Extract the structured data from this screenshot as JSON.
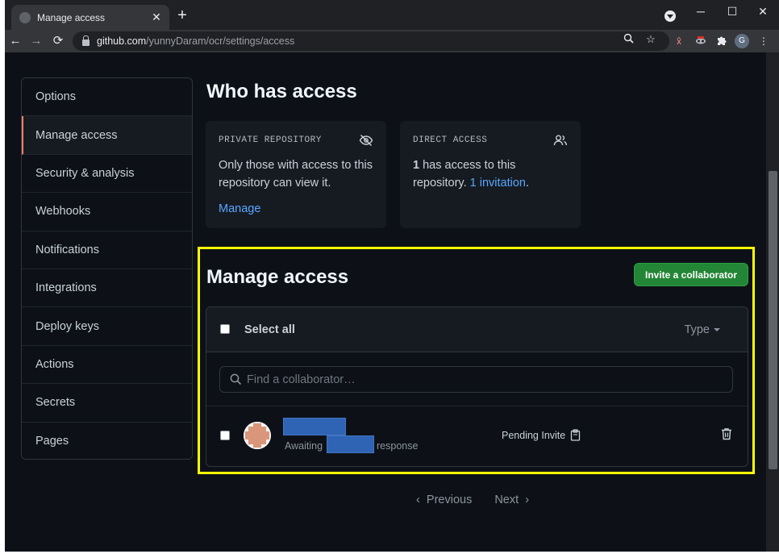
{
  "browser": {
    "tab_title": "Manage access",
    "tab_close": "✕",
    "new_tab": "+",
    "url_host": "github.com",
    "url_path": "/yunnyDaram/ocr/settings/access",
    "profile_initial": "G"
  },
  "sidebar": {
    "items": [
      {
        "label": "Options"
      },
      {
        "label": "Manage access"
      },
      {
        "label": "Security & analysis"
      },
      {
        "label": "Webhooks"
      },
      {
        "label": "Notifications"
      },
      {
        "label": "Integrations"
      },
      {
        "label": "Deploy keys"
      },
      {
        "label": "Actions"
      },
      {
        "label": "Secrets"
      },
      {
        "label": "Pages"
      }
    ],
    "active": "Manage access"
  },
  "who_has_access": {
    "title": "Who has access",
    "private_card": {
      "label": "PRIVATE REPOSITORY",
      "text": "Only those with access to this repository can view it.",
      "link": "Manage"
    },
    "direct_card": {
      "label": "DIRECT ACCESS",
      "count": "1",
      "text_before": " has access to this repository. ",
      "link": "1 invitation",
      "text_after": "."
    }
  },
  "manage_access": {
    "title": "Manage access",
    "invite_button": "Invite a collaborator",
    "select_all": "Select all",
    "type_filter": "Type",
    "search_placeholder": "Find a collaborator…",
    "member": {
      "awaiting_prefix": "Awaiting",
      "awaiting_suffix": "response",
      "status": "Pending Invite"
    }
  },
  "pagination": {
    "previous": "Previous",
    "next": "Next"
  },
  "colors": {
    "page_bg": "#0d1117",
    "accent_green": "#238636",
    "link_blue": "#58a6ff",
    "active_border": "#f78166",
    "highlight": "#ffff00"
  }
}
